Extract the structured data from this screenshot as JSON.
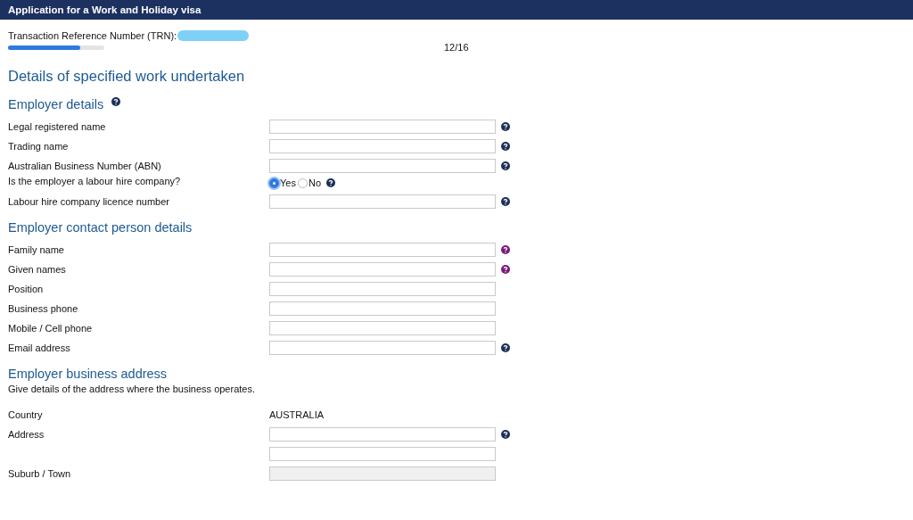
{
  "window": {
    "title": "Application for a Work and Holiday visa"
  },
  "trn": {
    "label": "Transaction Reference Number (TRN):"
  },
  "progress": {
    "step": "12/16",
    "level": 0.75
  },
  "page_heading": "Details of specified work undertaken",
  "sections": [
    {
      "heading": "Employer details",
      "help": {
        "color": "#1c2f55"
      },
      "rows": [
        {
          "kind": "text",
          "label": "Legal registered name",
          "help": {
            "color": "#1c2f55"
          }
        },
        {
          "kind": "text",
          "label": "Trading name",
          "help": {
            "color": "#1c2f55"
          }
        },
        {
          "kind": "text",
          "label": "Australian Business Number (ABN)",
          "help": {
            "color": "#1c2f55"
          }
        },
        {
          "kind": "radio",
          "label": "Is the employer a labour hire company?",
          "help": {
            "color": "#1c2f55"
          },
          "options": [
            {
              "label": "Yes",
              "selected": true
            },
            {
              "label": "No",
              "selected": false
            }
          ]
        },
        {
          "kind": "text",
          "label": "Labour hire company licence number",
          "help": {
            "color": "#1c2f55"
          }
        }
      ]
    },
    {
      "heading": "Employer contact person details",
      "rows": [
        {
          "kind": "text",
          "label": "Family name",
          "help": {
            "color": "#7a1a7a"
          }
        },
        {
          "kind": "text",
          "label": "Given names",
          "help": {
            "color": "#7a1a7a"
          }
        },
        {
          "kind": "text",
          "label": "Position"
        },
        {
          "kind": "text",
          "label": "Business phone"
        },
        {
          "kind": "text",
          "label": "Mobile / Cell phone"
        },
        {
          "kind": "text",
          "label": "Email address",
          "help": {
            "color": "#1c2f55"
          }
        }
      ]
    },
    {
      "heading": "Employer business address",
      "description": "Give details of the address where the business operates.",
      "rows": [
        {
          "kind": "static",
          "label": "Country",
          "value": "AUSTRALIA"
        },
        {
          "kind": "text",
          "label": "Address",
          "help": {
            "color": "#1c2f55"
          }
        },
        {
          "kind": "text"
        },
        {
          "kind": "text",
          "label": "Suburb / Town",
          "disabled": true
        }
      ]
    }
  ]
}
